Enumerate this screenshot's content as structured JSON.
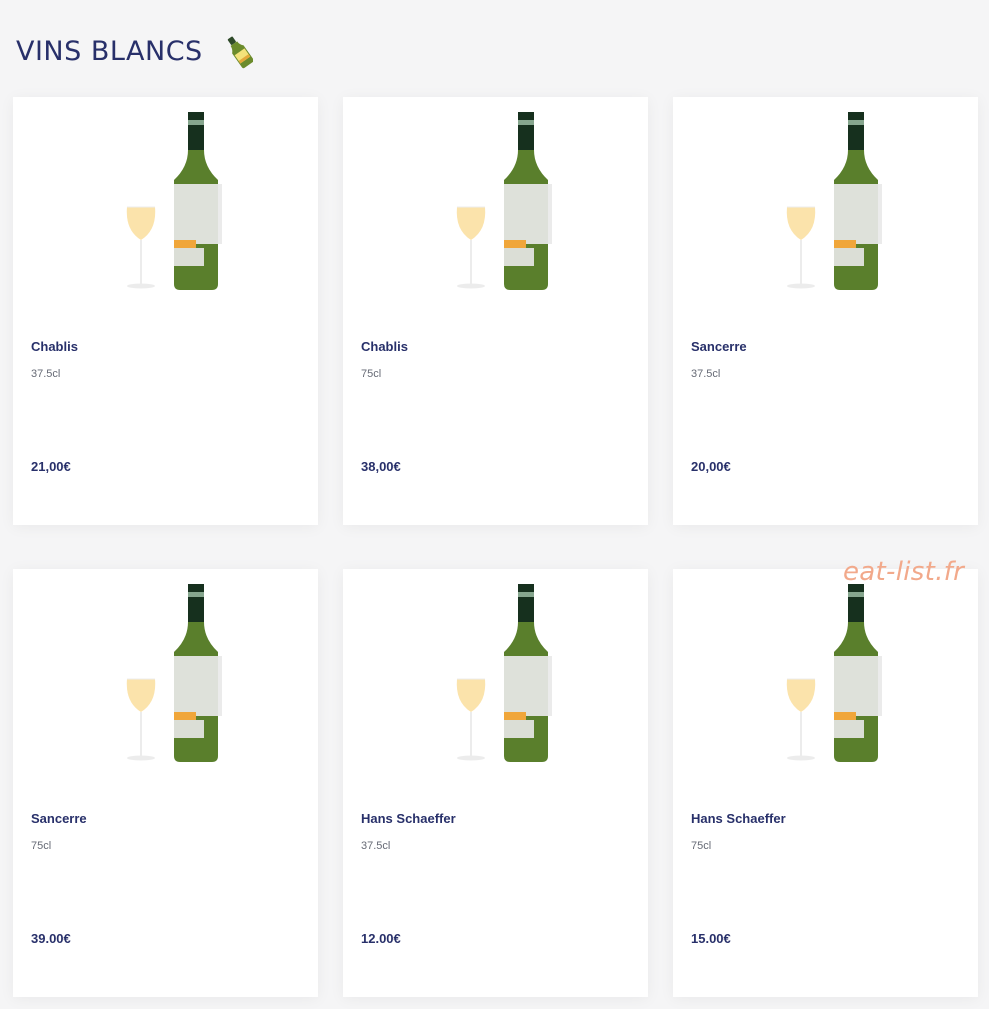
{
  "section": {
    "title": "VINS BLANCS",
    "icon": "wine-bottle-icon"
  },
  "watermark": "eat-list.fr",
  "colors": {
    "title": "#28306a",
    "bottle": "#5a7f2c",
    "bottle_neck": "#16301e",
    "wine": "#fbe2a6",
    "label_accent": "#f0a63a",
    "watermark": "#f2a98b"
  },
  "products": [
    {
      "name": "Chablis",
      "volume": "37.5cl",
      "price": "21,00€"
    },
    {
      "name": "Chablis",
      "volume": "75cl",
      "price": "38,00€"
    },
    {
      "name": "Sancerre",
      "volume": "37.5cl",
      "price": "20,00€"
    },
    {
      "name": "Sancerre",
      "volume": "75cl",
      "price": "39.00€"
    },
    {
      "name": "Hans Schaeffer",
      "volume": "37.5cl",
      "price": "12.00€"
    },
    {
      "name": "Hans Schaeffer",
      "volume": "75cl",
      "price": "15.00€"
    }
  ]
}
